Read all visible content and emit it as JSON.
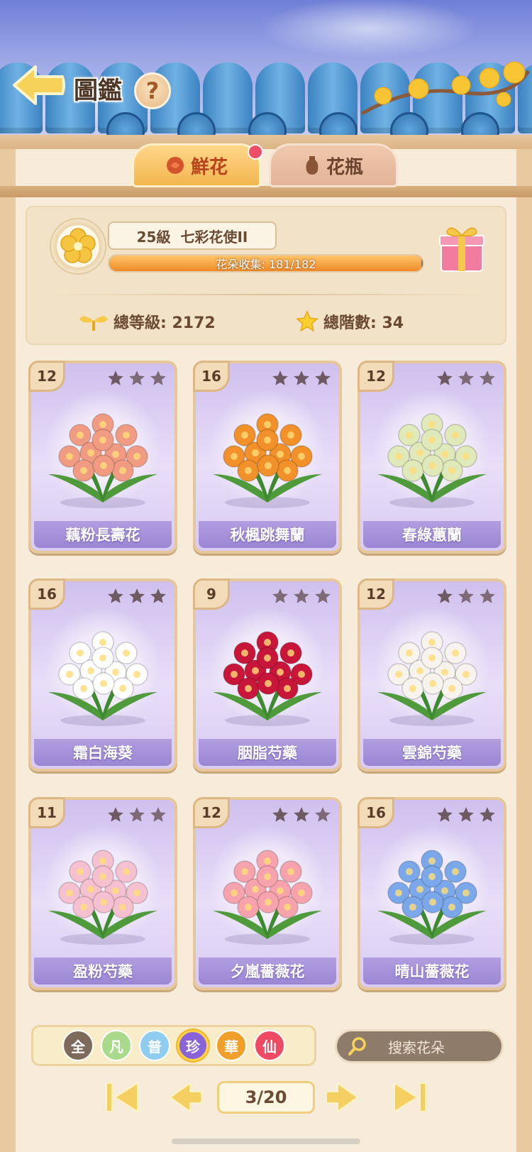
{
  "header": {
    "title": "圖鑑",
    "help_label": "?"
  },
  "tabs": [
    {
      "label": "鮮花",
      "active": true,
      "icon": "rose-icon",
      "has_notification": true
    },
    {
      "label": "花瓶",
      "active": false,
      "icon": "vase-icon",
      "has_notification": false
    }
  ],
  "summary": {
    "level": "25級",
    "rank_title": "七彩花使II",
    "collection_label": "花朵收集: 181/182",
    "collection_progress": 0.9945,
    "total_level_label": "總等級: 2172",
    "total_stars_label": "總階數: 34"
  },
  "cards": [
    {
      "level": "12",
      "stars": 1,
      "name": "藕粉長壽花",
      "color": "#f29b83"
    },
    {
      "level": "16",
      "stars": 3,
      "name": "秋楓跳舞蘭",
      "color": "#f2902a"
    },
    {
      "level": "12",
      "stars": 1,
      "name": "春綠蕙蘭",
      "color": "#dfe9b9"
    },
    {
      "level": "16",
      "stars": 3,
      "name": "霜白海葵",
      "color": "#ffffff"
    },
    {
      "level": "9",
      "stars": 0,
      "name": "胭脂芍藥",
      "color": "#c8163a"
    },
    {
      "level": "12",
      "stars": 1,
      "name": "雲錦芍藥",
      "color": "#f7f4ee"
    },
    {
      "level": "11",
      "stars": 1,
      "name": "盈粉芍藥",
      "color": "#f5c0d0"
    },
    {
      "level": "12",
      "stars": 2,
      "name": "夕嵐薔薇花",
      "color": "#f7a3ae"
    },
    {
      "level": "16",
      "stars": 3,
      "name": "晴山薔薇花",
      "color": "#7aa8ea"
    }
  ],
  "filters": [
    {
      "label": "全",
      "color": "#7d6a5b",
      "selected": false
    },
    {
      "label": "凡",
      "color": "#a9d98a",
      "selected": false
    },
    {
      "label": "普",
      "color": "#8fcdf0",
      "selected": false
    },
    {
      "label": "珍",
      "color": "#8a63d8",
      "selected": true
    },
    {
      "label": "華",
      "color": "#f0a02a",
      "selected": false
    },
    {
      "label": "仙",
      "color": "#ee4a63",
      "selected": false
    }
  ],
  "search": {
    "placeholder": "搜索花朵"
  },
  "pager": {
    "label": "3/20"
  }
}
